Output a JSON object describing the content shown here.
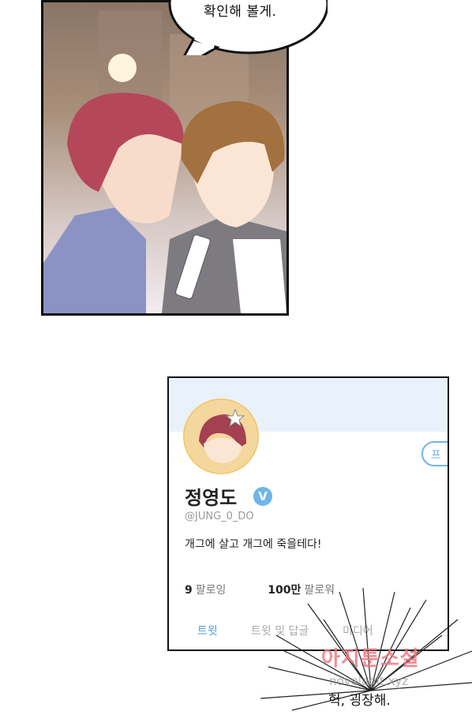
{
  "speech_bubble": {
    "text": "확인해 볼게."
  },
  "profile": {
    "name": "정영도",
    "verified_mark": "V",
    "handle": "@JUNG_0_DO",
    "bio": "개그에 살고 개그에 죽을테다!",
    "following_count": "9",
    "following_label": "팔로잉",
    "followers_count": "100만",
    "followers_label": "팔로워",
    "profile_button_label": "프",
    "tabs": [
      {
        "label": "트윗"
      },
      {
        "label": "트윗 및 답글"
      },
      {
        "label": "미디어"
      }
    ]
  },
  "exclamation": "헉, 굉장해.",
  "watermark": {
    "site_name": "아지툰소설",
    "url": "novelagit.xyz"
  },
  "colors": {
    "accent": "#4aa1e6",
    "header_bg": "#e9f2fb",
    "watermark": "#ee7880"
  }
}
